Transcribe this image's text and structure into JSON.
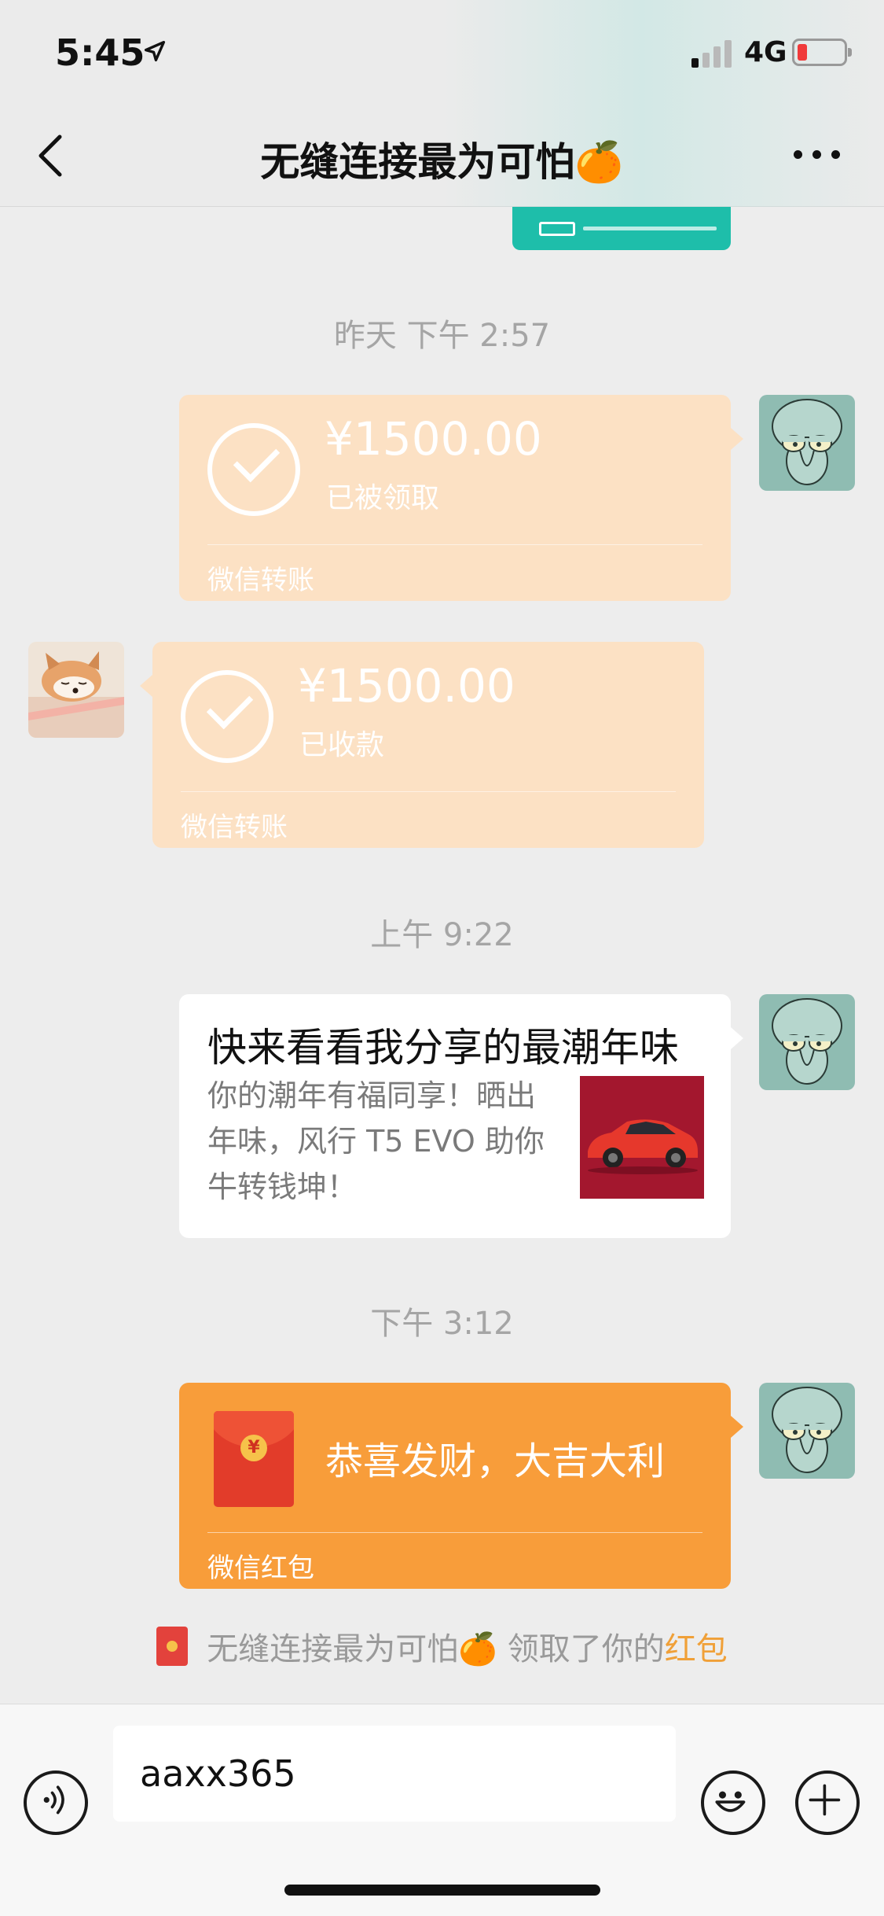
{
  "status_bar": {
    "time": "5:45",
    "network": "4G",
    "signal_bars_active": 1,
    "battery_level": 0.15,
    "battery_color": "#f03a3a"
  },
  "nav": {
    "title": "无缝连接最为可怕🍊",
    "back_icon": "chevron-left-icon",
    "more_icon": "more-dots-icon"
  },
  "messages": {
    "timestamp_1": "昨天 下午 2:57",
    "transfer_sent": {
      "amount": "¥1500.00",
      "status": "已被领取",
      "label": "微信转账"
    },
    "transfer_received": {
      "amount": "¥1500.00",
      "status": "已收款",
      "label": "微信转账"
    },
    "timestamp_2": "上午 9:22",
    "share_card": {
      "title": "快来看看我分享的最潮年味",
      "description": "你的潮年有福同享！晒出年味，风行 T5 EVO 助你牛转钱坤！"
    },
    "timestamp_3": "下午 3:12",
    "red_packet": {
      "text": "恭喜发财，大吉大利",
      "label": "微信红包",
      "color": "#f89d3a"
    },
    "system": {
      "prefix": "无缝连接最为可怕🍊 领取了你的",
      "link": "红包"
    }
  },
  "input_bar": {
    "value": "aaxx365",
    "voice_icon": "voice-icon",
    "emoji_icon": "emoji-icon",
    "plus_icon": "plus-icon"
  },
  "colors": {
    "background": "#ededed",
    "transfer_bubble": "#fce1c4",
    "link_orange": "#f0a038"
  }
}
